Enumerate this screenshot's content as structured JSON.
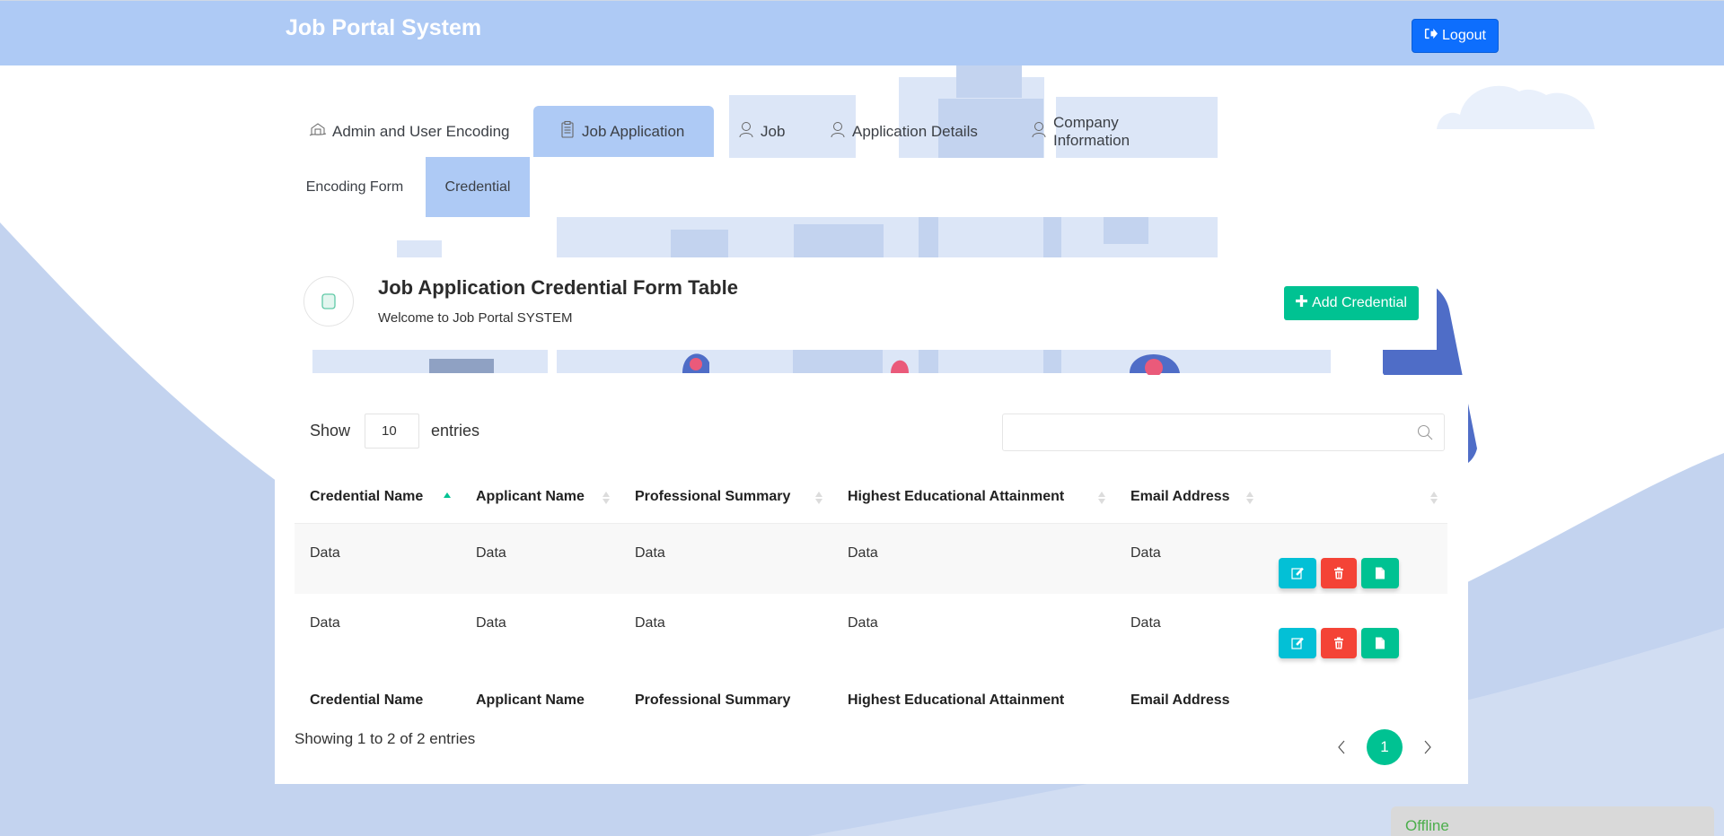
{
  "app": {
    "title": "Job Portal System",
    "logout_label": "Logout"
  },
  "tabs": [
    {
      "label": "Admin and User Encoding",
      "icon": "building-hand-icon",
      "active": false
    },
    {
      "label": "Job Application",
      "icon": "clipboard-icon",
      "active": true
    },
    {
      "label": "Job",
      "icon": "person-icon",
      "active": false
    },
    {
      "label": "Application Details",
      "icon": "person-icon",
      "active": false
    },
    {
      "label": "Company Information",
      "icon": "person-icon",
      "active": false
    }
  ],
  "subtabs": [
    {
      "label": "Encoding Form",
      "active": false
    },
    {
      "label": "Credential",
      "active": true
    }
  ],
  "page_header": {
    "title": "Job Application Credential Form Table",
    "subtitle": "Welcome to Job Portal SYSTEM",
    "add_button_label": "Add Credential"
  },
  "table_controls": {
    "show_label": "Show",
    "entries_label": "entries",
    "page_length": "10",
    "search_value": "",
    "search_placeholder": ""
  },
  "table": {
    "columns": [
      "Credential Name",
      "Applicant Name",
      "Professional Summary",
      "Highest Educational Attainment",
      "Email Address",
      ""
    ],
    "sorted_column": "Credential Name",
    "sort_direction": "ascending",
    "rows": [
      [
        "Data",
        "Data",
        "Data",
        "Data",
        "Data"
      ],
      [
        "Data",
        "Data",
        "Data",
        "Data",
        "Data"
      ]
    ],
    "row_actions": [
      "edit",
      "delete",
      "view"
    ]
  },
  "footer": {
    "info": "Showing 1 to 2 of 2 entries",
    "current_page": "1"
  },
  "status": {
    "label": "Offline",
    "color": "#4cae4c"
  },
  "colors": {
    "header_bg": "#aecaf5",
    "primary": "#0d6efd",
    "success": "#00c292",
    "info": "#03c0d6",
    "danger": "#f44336"
  }
}
